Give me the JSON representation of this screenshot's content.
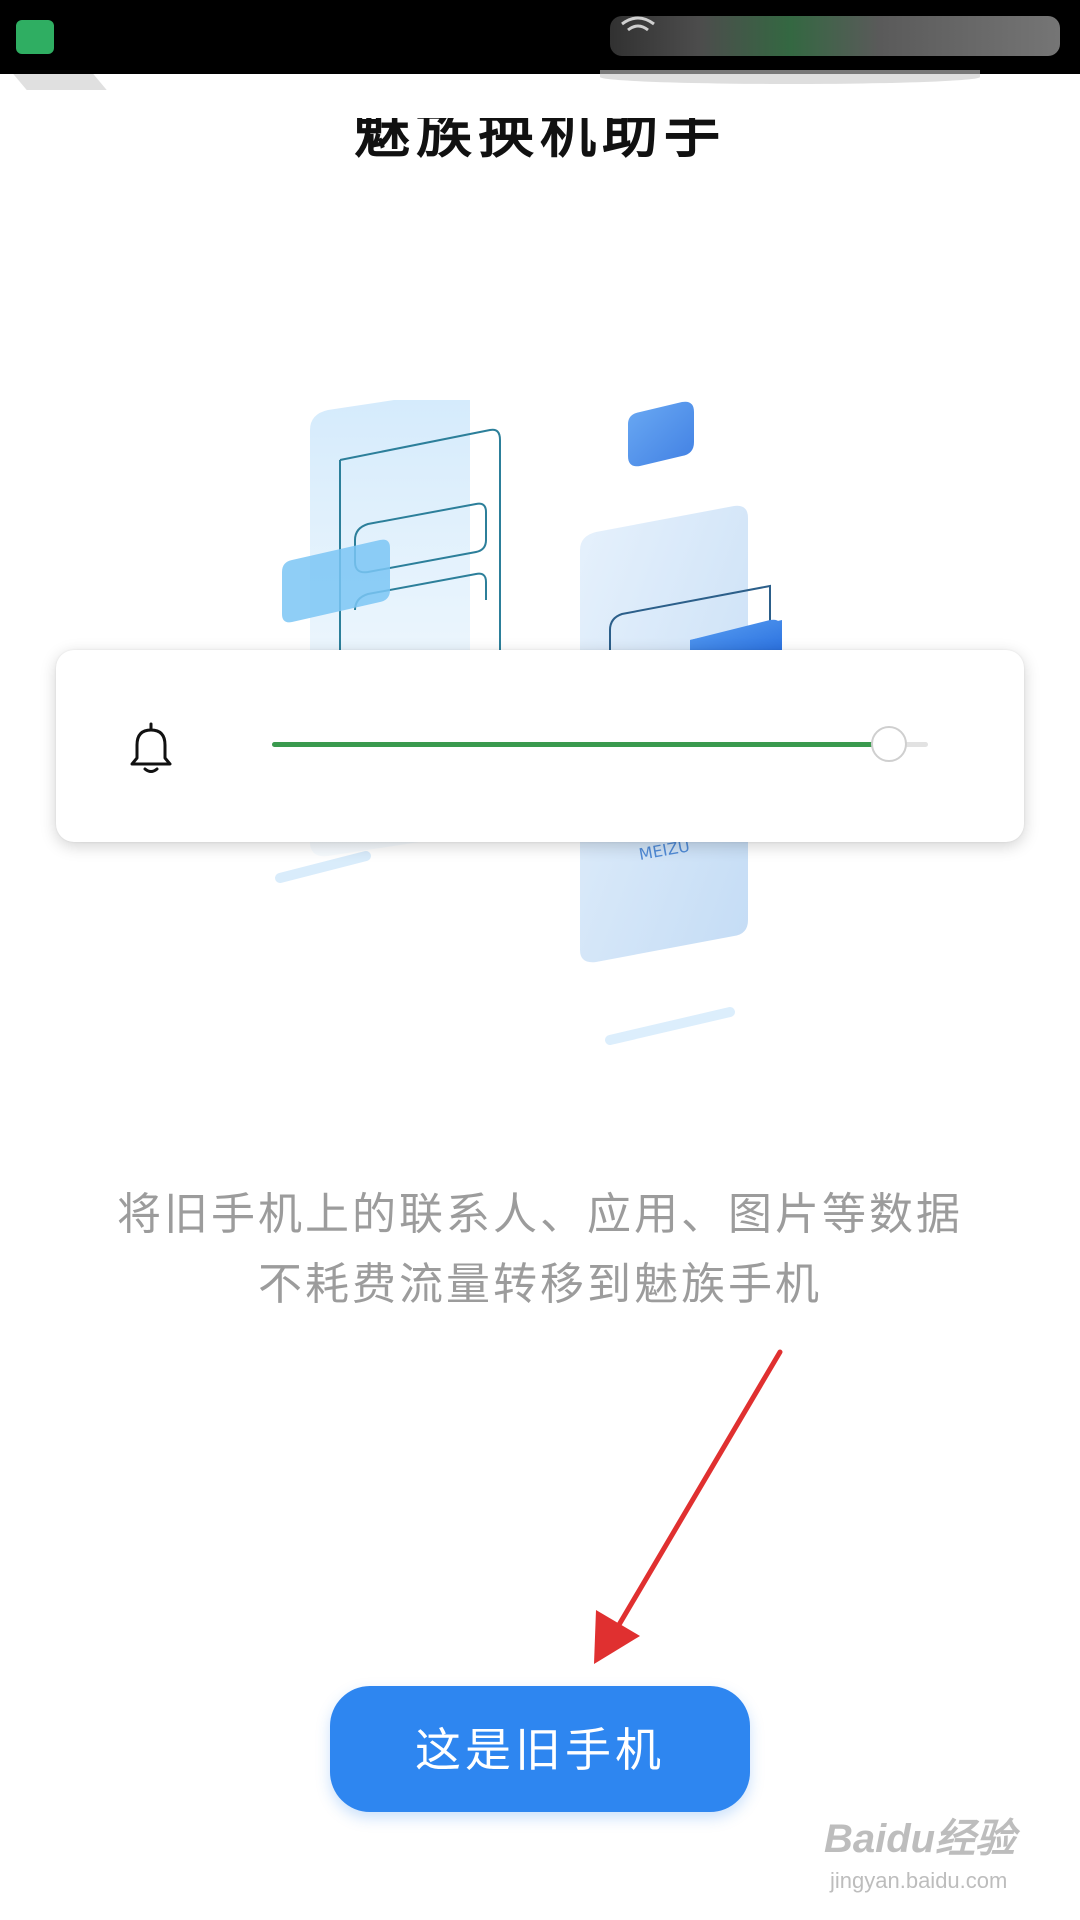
{
  "title": "魅族换机助手",
  "volume": {
    "level": 0.94,
    "icon": "bell-icon",
    "fill_color": "#3a9a4e"
  },
  "description": {
    "line1": "将旧手机上的联系人、应用、图片等数据",
    "line2": "不耗费流量转移到魅族手机"
  },
  "primary_button": {
    "label": "这是旧手机",
    "color": "#2e86f0"
  },
  "annotation": {
    "arrow_color": "#e03030"
  },
  "watermark": {
    "text": "Baidu经验",
    "url": "jingyan.baidu.com"
  },
  "colors": {
    "accent": "#2e86f0",
    "status_bar": "#000000",
    "description_text": "#9c9c9c"
  }
}
